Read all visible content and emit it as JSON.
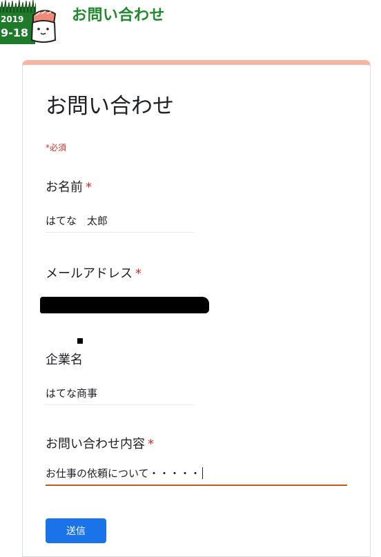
{
  "header": {
    "logo": {
      "year": "2019",
      "date": "9-18"
    },
    "title": "お問い合わせ"
  },
  "form": {
    "title": "お問い合わせ",
    "required_note": "*必須",
    "required_mark": "*",
    "questions": [
      {
        "label": "お名前",
        "required": true,
        "value": "はてな　太郎"
      },
      {
        "label": "メールアドレス",
        "required": true,
        "value": ""
      },
      {
        "label": "企業名",
        "required": false,
        "value": "はてな商事"
      },
      {
        "label": "お問い合わせ内容",
        "required": true,
        "value": "お仕事の依頼について・・・・・"
      }
    ],
    "submit_label": "送信"
  },
  "colors": {
    "accent_header": "#1f8a2c",
    "card_top_border": "#f7b5a2",
    "required": "#d93025",
    "focused_underline": "#c15a17",
    "submit_button": "#1a73e8"
  }
}
